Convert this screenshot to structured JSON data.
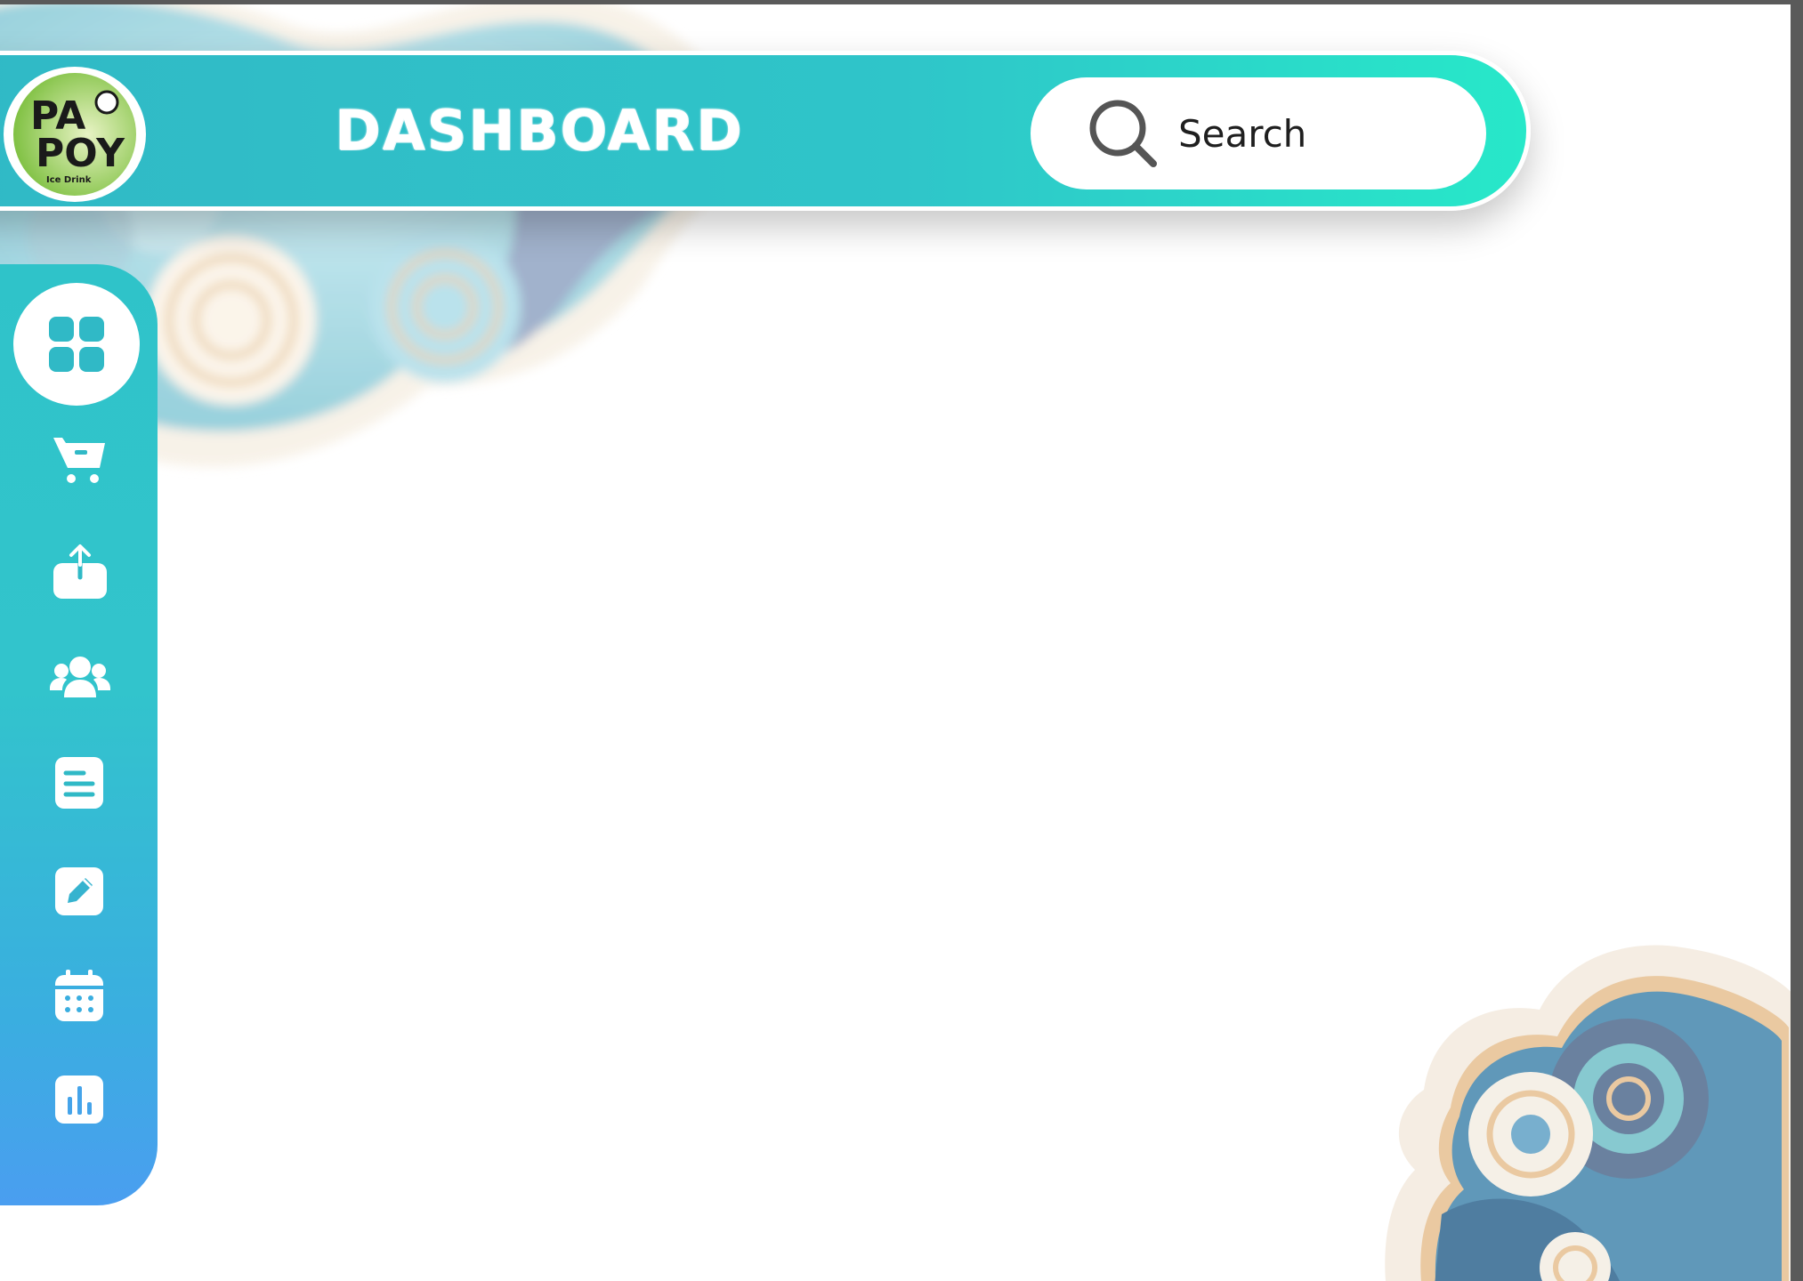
{
  "app": {
    "brand_logo": "papoy-ice-drink-logo",
    "logo_text": "PAPOY Ice Drink"
  },
  "header": {
    "title": "DASHBOARD",
    "search": {
      "placeholder": "Search",
      "icon": "search-icon"
    }
  },
  "sidebar": {
    "items": [
      {
        "name": "dashboard",
        "icon": "grid-icon",
        "active": true
      },
      {
        "name": "cart",
        "icon": "cart-icon"
      },
      {
        "name": "upload",
        "icon": "upload-icon"
      },
      {
        "name": "customers",
        "icon": "users-icon"
      },
      {
        "name": "documents",
        "icon": "document-icon"
      },
      {
        "name": "edit",
        "icon": "edit-icon"
      },
      {
        "name": "calendar",
        "icon": "calendar-icon"
      },
      {
        "name": "reports",
        "icon": "bar-chart-icon"
      }
    ]
  },
  "colors": {
    "accent": "#30b9c6",
    "accent_light": "#27e8c9",
    "sidebar_bottom": "#4a9ef0",
    "icon": "#ffffff"
  }
}
